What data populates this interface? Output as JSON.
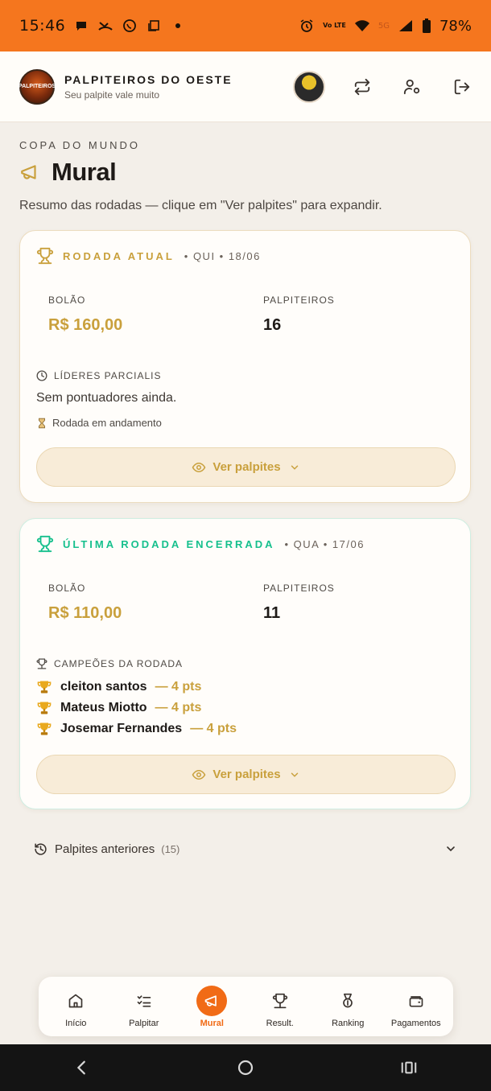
{
  "status_bar": {
    "time": "15:46",
    "battery": "78%",
    "network": "5G",
    "volte": "Vo LTE"
  },
  "header": {
    "logo_text": "PALPITEIROS",
    "brand_name": "PALPITEIROS DO OESTE",
    "tagline": "Seu palpite vale muito"
  },
  "page": {
    "eyebrow": "COPA DO MUNDO",
    "title": "Mural",
    "subtitle": "Resumo das rodadas — clique em \"Ver palpites\" para expandir."
  },
  "current_round": {
    "label": "RODADA ATUAL",
    "date": "• QUI • 18/06",
    "pot_label": "BOLÃO",
    "pot_value": "R$ 160,00",
    "players_label": "PALPITEIROS",
    "players_value": "16",
    "leaders_label": "LÍDERES PARCIALIS",
    "leaders_empty": "Sem pontuadores ainda.",
    "status": "Rodada em andamento",
    "button": "Ver palpites"
  },
  "last_round": {
    "label": "ÚLTIMA RODADA ENCERRADA",
    "date": "• QUA • 17/06",
    "pot_label": "BOLÃO",
    "pot_value": "R$ 110,00",
    "players_label": "PALPITEIROS",
    "players_value": "11",
    "champions_label": "CAMPEÕES DA RODADA",
    "champions": [
      {
        "name": "cleiton santos",
        "points": "— 4 pts"
      },
      {
        "name": "Mateus Miotto",
        "points": "— 4 pts"
      },
      {
        "name": "Josemar Fernandes",
        "points": "— 4 pts"
      }
    ],
    "button": "Ver palpites"
  },
  "previous": {
    "label": "Palpites anteriores",
    "count": "(15)"
  },
  "bottom_nav": [
    {
      "label": "Início",
      "icon": "home-icon"
    },
    {
      "label": "Palpitar",
      "icon": "checklist-icon"
    },
    {
      "label": "Mural",
      "icon": "megaphone-icon",
      "active": true
    },
    {
      "label": "Result.",
      "icon": "trophy-icon"
    },
    {
      "label": "Ranking",
      "icon": "medal-icon"
    },
    {
      "label": "Pagamentos",
      "icon": "wallet-icon"
    }
  ],
  "colors": {
    "accent_orange": "#f5761e",
    "gold": "#c9a03c",
    "teal": "#16c08d",
    "background": "#f3efe9"
  }
}
